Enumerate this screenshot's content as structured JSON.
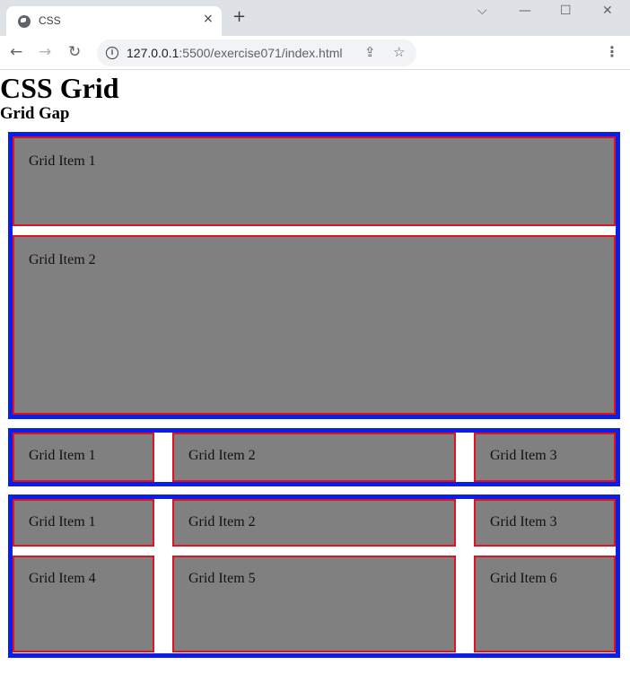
{
  "browser": {
    "tab_title": "CSS",
    "tab_close_icon": "×",
    "new_tab_icon": "+",
    "window_controls": {
      "dropdown": "⌵",
      "minimize": "—",
      "maximize": "☐",
      "close": "✕"
    },
    "nav": {
      "back": "←",
      "forward": "→",
      "reload": "↻"
    },
    "url_host": "127.0.0.1",
    "url_rest": ":5500/exercise071/index.html",
    "info_icon": "i",
    "share_icon": "⇪",
    "bookmark_icon": "☆",
    "menu_icon": "⋮"
  },
  "page": {
    "title": "CSS Grid",
    "subtitle": "Grid Gap",
    "grid1": [
      "Grid Item 1",
      "Grid Item 2"
    ],
    "grid2": [
      "Grid Item 1",
      "Grid Item 2",
      "Grid Item 3"
    ],
    "grid3": [
      "Grid Item 1",
      "Grid Item 2",
      "Grid Item 3",
      "Grid Item 4",
      "Grid Item 5",
      "Grid Item 6"
    ]
  },
  "colors": {
    "container_border": "#0b1ee8",
    "item_border": "#e0141e",
    "item_background": "#808080"
  }
}
